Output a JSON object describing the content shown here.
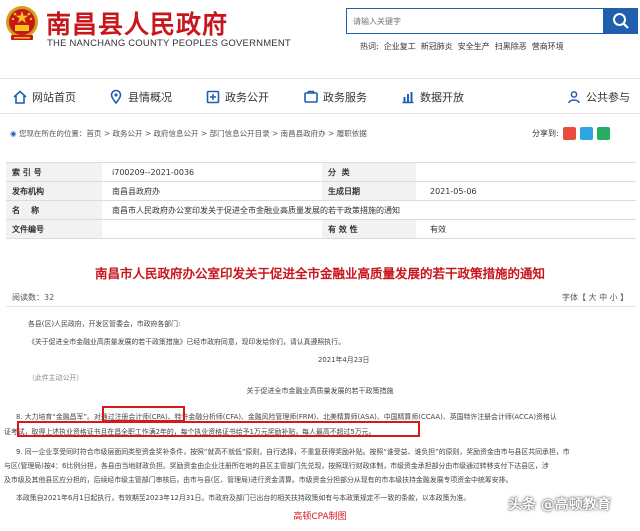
{
  "header": {
    "title": "南昌县人民政府",
    "subtitle": "THE NANCHANG COUNTY PEOPLES GOVERNMENT",
    "search_placeholder": "请输入关键字",
    "hot_label": "热词:",
    "hot_words": [
      "企业复工",
      "新冠肺炎",
      "安全生产",
      "扫黑除恶",
      "营商环境"
    ]
  },
  "nav": {
    "items": [
      {
        "label": "网站首页",
        "icon": "home-icon"
      },
      {
        "label": "县情概况",
        "icon": "location-icon"
      },
      {
        "label": "政务公开",
        "icon": "open-icon"
      },
      {
        "label": "政务服务",
        "icon": "service-icon"
      },
      {
        "label": "数据开放",
        "icon": "chart-icon"
      },
      {
        "label": "公共参与",
        "icon": "people-icon"
      }
    ]
  },
  "breadcrumb": {
    "text": "您现在所在的位置：首页 > 政务公开 > 政府信息公开 > 部门信息公开目录 > 南昌县政府办 > 履职依据"
  },
  "share": {
    "label": "分享到:"
  },
  "info": {
    "index_label": "索 引 号",
    "index_value": "i700209--2021-0036",
    "category_label": "分  类",
    "category_value": "",
    "publisher_label": "发布机构",
    "publisher_value": "南昌县政府办",
    "date_label": "生成日期",
    "date_value": "2021-05-06",
    "name_label": "名    称",
    "name_value": "南昌市人民政府办公室印发关于促进全市金融业高质量发展的若干政策措施的通知",
    "doc_no_label": "文件编号",
    "doc_no_value": "",
    "validity_label": "有 效 性",
    "validity_value": "有效"
  },
  "article": {
    "title": "南昌市人民政府办公室印发关于促进全市金融业高质量发展的若干政策措施的通知",
    "reads_label": "阅读数：",
    "reads": "32",
    "font_size_label": "字体【 大 中 小 】",
    "p1": "各县(区)人民政府，开发区管委会，市政府各部门:",
    "p2": "《关于促进全市金融业高质量发展的若干政策措施》已经市政府同意，现印发给你们，请认真遵照执行。",
    "date": "2021年4月23日",
    "p3": "（此件主动公开）",
    "doc_title": "关于促进全市金融业高质量发展的若干政策措施",
    "p8_a": "8. 大力培育“金融昌军”。对通过注册会计师(CPA)、特许金融分析师(CFA)、金融风险管理师(FRM)、北美精算师(ASA)、中国精算师(CCAA)、英国特许注册会计师(ACCA)资格认",
    "p8_b": "证考试，取得上述执业资格证书且在昌全职工作满2年的，每个执业资格证书给予1万元奖励补贴，每人最高不超过5万元。",
    "p9_a": "9. 同一企业享受同时符合市级层面同类型资金奖补条件，按照“就高不就低”原则，自行选择，不重复获得奖励补贴。按照“谁受益、谁负担”的原则，奖励资金由市与县区共同承担，市",
    "p9_b": "与区(管理局)按4：6比例分担，各县由当地财政负担。奖励资金由企业注册所在地的县区主管部门先兑现，按照现行财政体制，市级资金承担部分由市级通过转移支付下达县区，涉",
    "p9_c": "及市级及其他县区应分担的，后续经市级主管部门审核后，由市与县(区、管理局)进行资金清算。市级资金分担部分从现有的市本级扶持金融发展专项资金中统筹安排。",
    "p10": "本政策自2021年6月1日起执行，有效期至2023年12月31日。市政府及部门已出台的相关扶持政策如有与本政策规定不一致的条款，以本政策为准。",
    "caption": "高顿CPA制图"
  },
  "watermark": "头条 @高顿教育",
  "colors": {
    "brand_red": "#c8161d",
    "nav_blue": "#1f5fae",
    "highlight": "#d8191c"
  }
}
